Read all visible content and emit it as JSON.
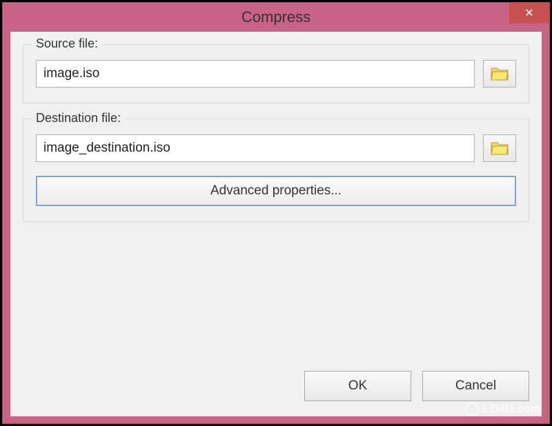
{
  "window": {
    "title": "Compress",
    "close_icon": "✕"
  },
  "source": {
    "label": "Source file:",
    "value": "image.iso"
  },
  "destination": {
    "label": "Destination file:",
    "value": "image_destination.iso",
    "advanced_label": "Advanced properties..."
  },
  "buttons": {
    "ok": "OK",
    "cancel": "Cancel"
  },
  "watermark": {
    "text": "LO4D.com",
    "icon": "↓"
  }
}
